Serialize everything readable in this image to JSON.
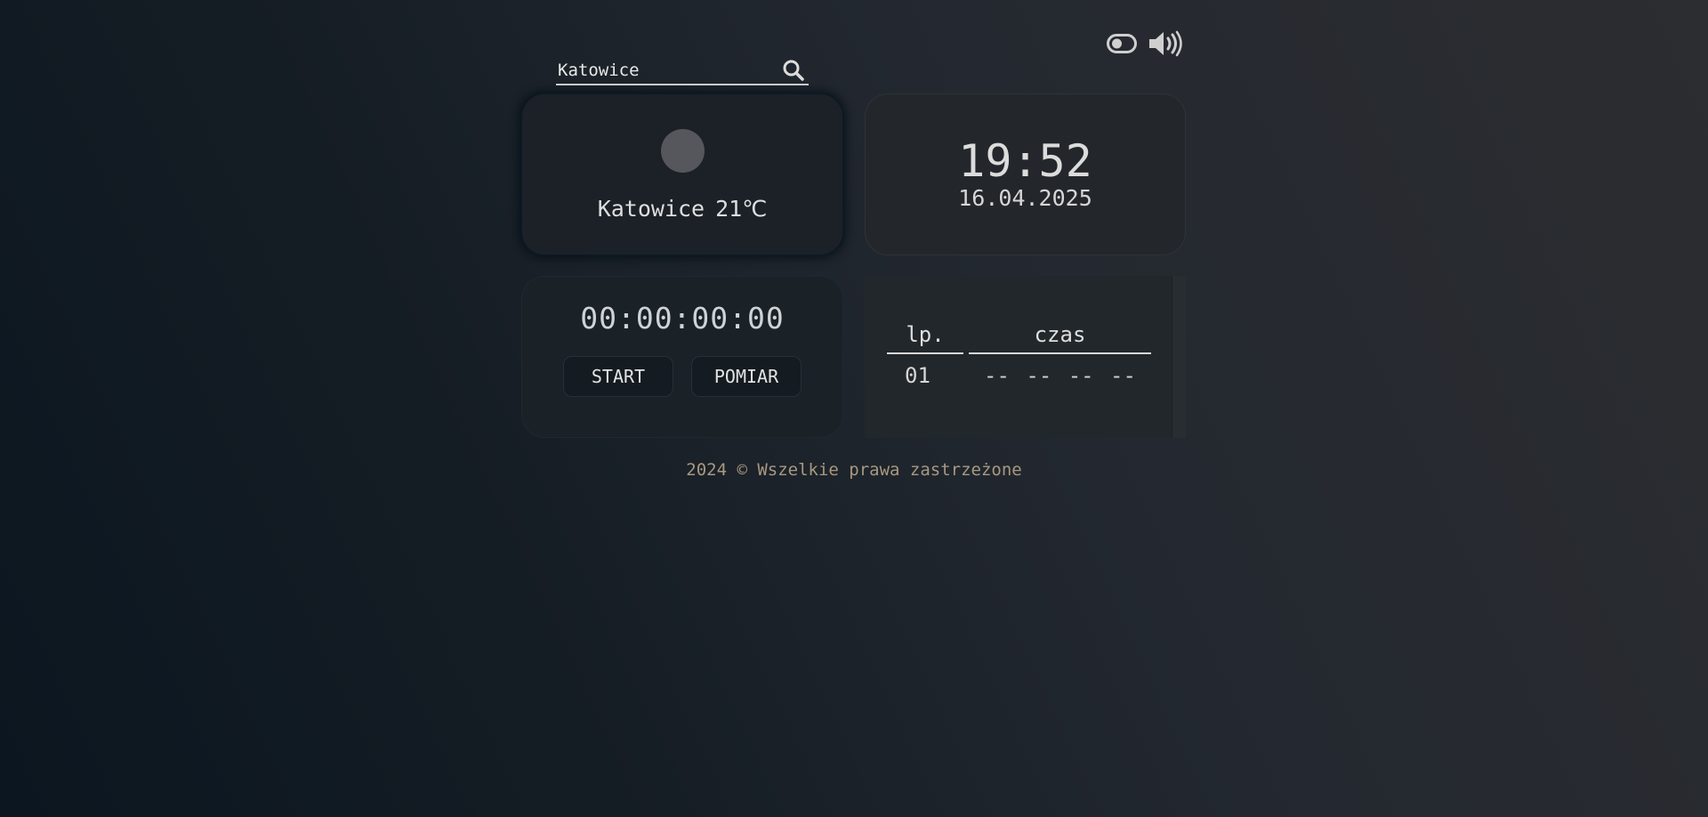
{
  "header": {
    "theme_toggle_icon": "toggle-icon",
    "sound_icon": "speaker-volume-icon"
  },
  "search": {
    "value": "Katowice",
    "icon": "search-icon"
  },
  "weather": {
    "city": "Katowice",
    "temperature": "21℃"
  },
  "clock": {
    "time": "19:52",
    "date": "16.04.2025"
  },
  "stopwatch": {
    "display": "00:00:00:00",
    "start_label": "START",
    "measure_label": "POMIAR"
  },
  "laps": {
    "headers": [
      "lp.",
      "czas"
    ],
    "rows": [
      {
        "lp": "01",
        "czas": "-- -- -- --"
      }
    ]
  },
  "footer": {
    "text": "2024 © Wszelkie prawa zastrzeżone"
  },
  "colors": {
    "accent_text": "#dcdcdc",
    "footer_text": "#a89880",
    "weather_icon": "#56575c"
  }
}
